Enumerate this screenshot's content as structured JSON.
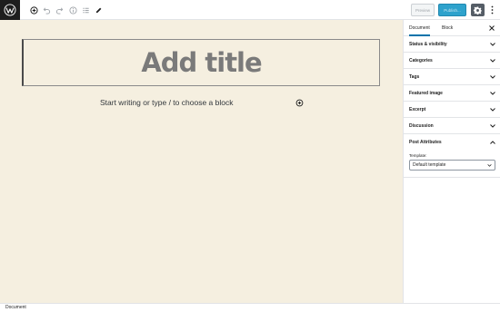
{
  "toolbar": {
    "logo_icon": "wordpress-logo-icon",
    "icons": [
      "add-block-icon",
      "undo-icon",
      "redo-icon",
      "info-icon",
      "list-view-icon",
      "tools-pencil-icon"
    ],
    "preview_label": "Preview",
    "publish_label": "Publish...",
    "settings_icon": "gear-icon",
    "more_icon": "more-vertical-icon",
    "accent_color": "#2ea2cc"
  },
  "editor": {
    "title_placeholder": "Add title",
    "block_placeholder": "Start writing or type / to choose a block",
    "inserter_icon": "add-block-icon",
    "background_color": "#f5efe0"
  },
  "sidebar": {
    "tabs": [
      {
        "label": "Document",
        "active": true
      },
      {
        "label": "Block",
        "active": false
      }
    ],
    "close_icon": "close-icon",
    "panels": [
      {
        "label": "Status & visibility",
        "expanded": false
      },
      {
        "label": "Categories",
        "expanded": false
      },
      {
        "label": "Tags",
        "expanded": false
      },
      {
        "label": "Featured image",
        "expanded": false
      },
      {
        "label": "Excerpt",
        "expanded": false
      },
      {
        "label": "Discussion",
        "expanded": false
      },
      {
        "label": "Post Attributes",
        "expanded": true
      }
    ],
    "post_attributes": {
      "template_label": "Template:",
      "template_value": "Default template"
    }
  },
  "footer": {
    "breadcrumb": "Document"
  }
}
